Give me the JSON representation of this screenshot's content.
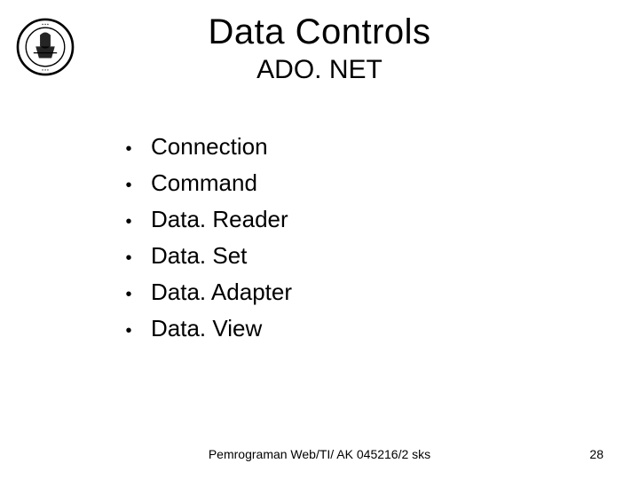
{
  "title": "Data Controls",
  "subtitle": "ADO. NET",
  "bullets": [
    "Connection",
    "Command",
    "Data. Reader",
    "Data. Set",
    "Data. Adapter",
    "Data. View"
  ],
  "footer": "Pemrograman Web/TI/ AK 045216/2 sks",
  "page_number": "28",
  "logo_alt": "university-seal"
}
